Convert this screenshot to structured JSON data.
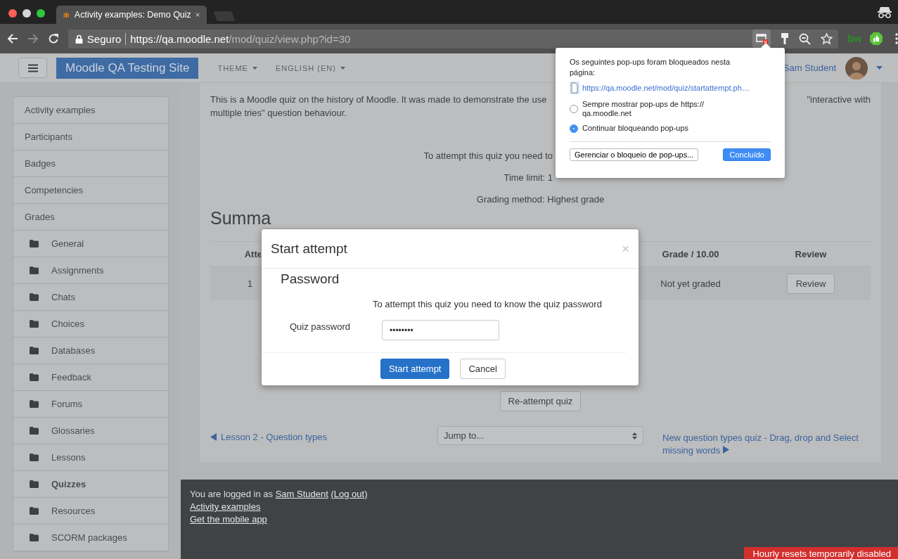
{
  "browser": {
    "tab_title": "Activity examples: Demo Quiz",
    "security_label": "Seguro",
    "url_host": "https://qa.moodle.net",
    "url_path": "/mod/quiz/view.php?id=30",
    "extension_label": "bw"
  },
  "navbar": {
    "site_name": "Moodle QA Testing Site",
    "menus": [
      "THEME",
      "ENGLISH (EN)"
    ],
    "user_name": "Sam Student"
  },
  "sidebar": {
    "items": [
      {
        "label": "Activity examples",
        "kind": "link",
        "selected": false
      },
      {
        "label": "Participants",
        "kind": "link",
        "selected": false
      },
      {
        "label": "Badges",
        "kind": "link",
        "selected": false
      },
      {
        "label": "Competencies",
        "kind": "link",
        "selected": false
      },
      {
        "label": "Grades",
        "kind": "link",
        "selected": false
      },
      {
        "label": "General",
        "kind": "folder",
        "selected": false
      },
      {
        "label": "Assignments",
        "kind": "folder",
        "selected": false
      },
      {
        "label": "Chats",
        "kind": "folder",
        "selected": false
      },
      {
        "label": "Choices",
        "kind": "folder",
        "selected": false
      },
      {
        "label": "Databases",
        "kind": "folder",
        "selected": false
      },
      {
        "label": "Feedback",
        "kind": "folder",
        "selected": false
      },
      {
        "label": "Forums",
        "kind": "folder",
        "selected": false
      },
      {
        "label": "Glossaries",
        "kind": "folder",
        "selected": false
      },
      {
        "label": "Lessons",
        "kind": "folder",
        "selected": false
      },
      {
        "label": "Quizzes",
        "kind": "folder",
        "selected": true
      },
      {
        "label": "Resources",
        "kind": "folder",
        "selected": false
      },
      {
        "label": "SCORM packages",
        "kind": "folder",
        "selected": false
      }
    ]
  },
  "quiz": {
    "intro_line1_start": "This is a Moodle quiz on the history of Moodle. It was made to demonstrate the use",
    "intro_line1_end": "\"interactive with",
    "intro_line2": "multiple tries\" question behaviour.",
    "info_lines": [
      {
        "text": "To attempt this quiz you need to",
        "truncated": true
      },
      {
        "text": "Time limit: 1",
        "truncated": true
      },
      {
        "text": "Grading method: Highest grade",
        "truncated": false
      }
    ],
    "summary_heading": "Summa",
    "table": {
      "columns": [
        "Atte",
        "Grade / 10.00",
        "Review"
      ],
      "rows": [
        {
          "attempt": "1",
          "grade": "Not yet graded",
          "review": "Review"
        }
      ]
    },
    "reattempt_button": "Re-attempt quiz",
    "prev_link": "Lesson 2 - Question types",
    "jump_select": {
      "value": "Jump to..."
    },
    "next_link": "New question types quiz - Drag, drop and Select missing words"
  },
  "footer": {
    "logged_in_prefix": "You are logged in as",
    "user_link": "Sam Student",
    "logout_link": "(Log out)",
    "links": [
      "Activity examples",
      "Get the mobile app"
    ],
    "notice": "Hourly resets temporarily disabled"
  },
  "modal": {
    "title": "Start attempt",
    "close": "×",
    "legend": "Password",
    "message": "To attempt this quiz you need to know the quiz password",
    "field_label": "Quiz password",
    "password_value": "••••••••",
    "buttons": [
      {
        "label": "Start attempt",
        "kind": "primary"
      },
      {
        "label": "Cancel",
        "kind": "secondary"
      }
    ]
  },
  "popup_blocker": {
    "heading": "Os seguintes pop-ups foram bloqueados nesta página:",
    "blocked_url": "https://qa.moodle.net/mod/quiz/startattempt.ph…",
    "options": [
      {
        "label": "Sempre mostrar pop-ups de https:// qa.moodle.net",
        "selected": false
      },
      {
        "label": "Continuar bloqueando pop-ups",
        "selected": true
      }
    ],
    "manage_button": "Gerenciar o bloqueio de pop-ups...",
    "done_button": "Concluído"
  }
}
